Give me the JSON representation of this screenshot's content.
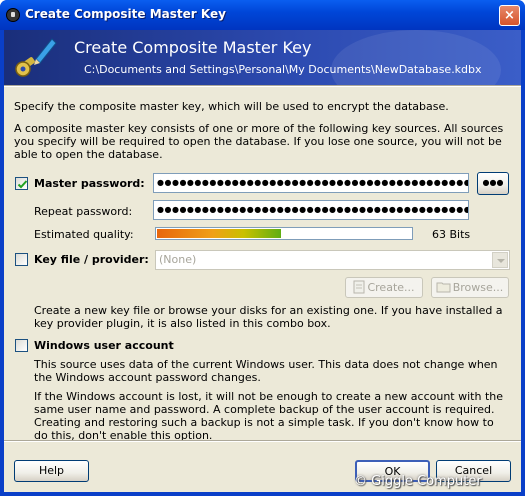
{
  "window": {
    "title": "Create Composite Master Key",
    "close_label": "×"
  },
  "banner": {
    "title": "Create Composite Master Key",
    "path": "C:\\Documents and Settings\\Personal\\My Documents\\NewDatabase.kdbx"
  },
  "intro": {
    "line1": "Specify the composite master key, which will be used to encrypt the database.",
    "line2": "A composite master key consists of one or more of the following key sources. All sources you specify will be required to open the database.  If you lose one source, you will not be able to open the database."
  },
  "master_password": {
    "label": "Master password:",
    "checked": true,
    "value": "●●●●●●●●●●●●●●●●●●●●●●●●●●●●●●●●●●●●●●●●●●●●●●●●●●●●●●●●",
    "toggle_label": "●●●"
  },
  "repeat_password": {
    "label": "Repeat password:",
    "value": "●●●●●●●●●●●●●●●●●●●●●●●●●●●●●●●●●●●●●●●●●●●●●●●●●●●●●●●●"
  },
  "quality": {
    "label": "Estimated quality:",
    "value_text": "63 Bits",
    "fraction": 0.49
  },
  "key_file": {
    "label": "Key file / provider:",
    "checked": false,
    "combo_value": "(None)",
    "create_label": "Create...",
    "browse_label": "Browse...",
    "help": "Create a new key file or browse your disks for an existing one. If you have installed a key provider plugin, it is also listed in this combo box."
  },
  "windows_account": {
    "label": "Windows user account",
    "checked": false,
    "help1": "This source uses data of the current Windows user. This data does not change when the Windows account password changes.",
    "help2": "If the Windows account is lost, it will not be enough to create a new account with the same user name and password. A complete backup of the user account is required. Creating and restoring such a backup is not a simple task. If you don't know how to do this, don't enable this option."
  },
  "buttons": {
    "help": "Help",
    "ok": "OK",
    "cancel": "Cancel"
  },
  "watermark": "© Giggle Computer",
  "colors": {
    "title_bar": "#0046d8",
    "dialog_face": "#ece9d8",
    "banner": "#2c4ab0"
  }
}
